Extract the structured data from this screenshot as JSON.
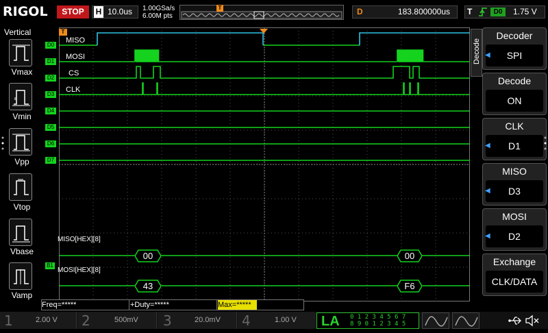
{
  "header": {
    "logo": "RIGOL",
    "run_state": "STOP",
    "timebase_label": "H",
    "timebase": "10.0us",
    "sample_rate": "1.00GSa/s",
    "memory_depth": "6.00M pts",
    "trigger_pos_marker": "T",
    "delay_label": "D",
    "delay": "183.800000us",
    "trigger_label": "T",
    "trigger_source": "D0",
    "trigger_level": "1.75 V"
  },
  "vertical_menu": {
    "title": "Vertical",
    "items": [
      {
        "label": "Vmax"
      },
      {
        "label": "Vmin"
      },
      {
        "label": "Vpp"
      },
      {
        "label": "Vtop"
      },
      {
        "label": "Vbase"
      },
      {
        "label": "Vamp"
      }
    ]
  },
  "channels": [
    {
      "tag": "D0",
      "label": "MISO"
    },
    {
      "tag": "D1",
      "label": "MOSI"
    },
    {
      "tag": "D2",
      "label": "CS"
    },
    {
      "tag": "D3",
      "label": "CLK"
    },
    {
      "tag": "D4",
      "label": ""
    },
    {
      "tag": "D5",
      "label": ""
    },
    {
      "tag": "D6",
      "label": ""
    },
    {
      "tag": "D7",
      "label": ""
    }
  ],
  "trigger_marker": "T",
  "bus_marker": "B1",
  "decode": {
    "miso_label": "MISO[HEX][8]",
    "mosi_label": "MOSI[HEX][8]",
    "miso_values": [
      "00",
      "00"
    ],
    "mosi_values": [
      "43",
      "F6"
    ]
  },
  "right_menu": {
    "tab": "Decode",
    "panels": [
      {
        "title": "Decoder",
        "value": "SPI"
      },
      {
        "title": "Decode",
        "value": "ON"
      },
      {
        "title": "CLK",
        "value": "D1"
      },
      {
        "title": "MISO",
        "value": "D3"
      },
      {
        "title": "MOSI",
        "value": "D2"
      },
      {
        "title": "Exchange",
        "value": "CLK/DATA"
      }
    ]
  },
  "measure": {
    "freq": "Freq=*****",
    "duty": "+Duty=*****",
    "max": "Max=*****"
  },
  "bottom": {
    "ch1_num": "1",
    "ch1_val": "2.00 V",
    "ch2_num": "2",
    "ch2_val": "500mV",
    "ch3_num": "3",
    "ch3_val": "20.0mV",
    "ch4_num": "4",
    "ch4_val": "1.00 V",
    "la": "LA",
    "la_row1": "0 1 2 3   4 5 6 7",
    "la_row2": "8 9 0 1   2 3 4 5"
  },
  "colors": {
    "trace": "#14d21e",
    "grid": "#555555",
    "trigger": "#f08a1a",
    "miso_cyan": "#2fc6e8",
    "stop": "#c0181c"
  }
}
